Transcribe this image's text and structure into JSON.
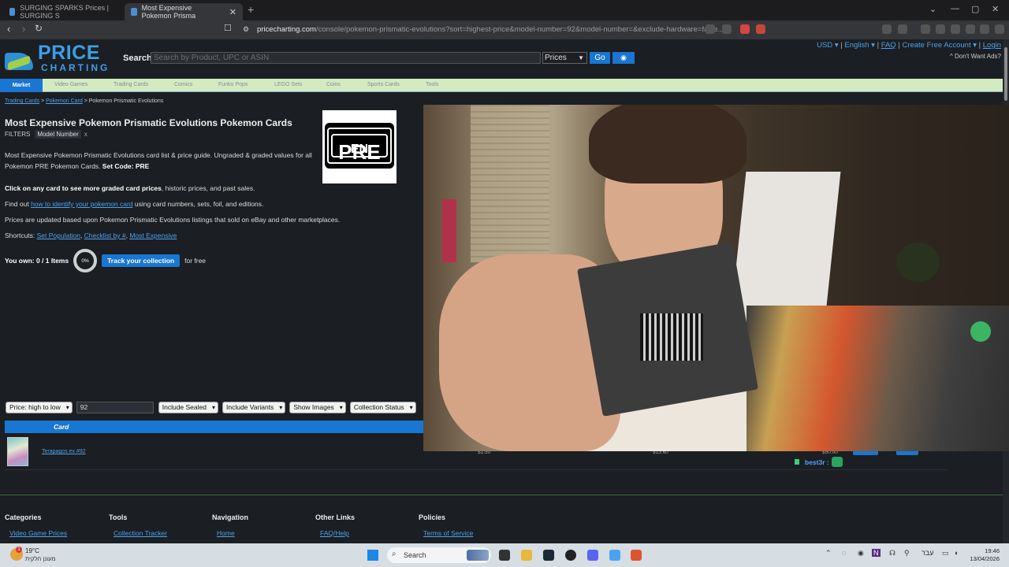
{
  "browser": {
    "tabs": [
      {
        "title": "SURGING SPARKS Prices | SURGING S"
      },
      {
        "title": "Most Expensive Pokemon Prisma"
      }
    ],
    "url_host": "pricecharting.com",
    "url_path": "/console/pokemon-prismatic-evolutions?sort=highest-price&model-number=92&model-number=&exclude-hardware=false..."
  },
  "header": {
    "logo_line1": "PRICE",
    "logo_line2": "CHARTING",
    "search_label": "Search",
    "search_placeholder": "Search by Product, UPC or ASIN",
    "search_type": "Prices",
    "go_label": "Go",
    "links": [
      "USD ▾",
      "English ▾",
      "FAQ",
      "Create Free Account ▾",
      "Login"
    ],
    "dont_want_ads": "^ Don't Want Ads?"
  },
  "categories": [
    "Market",
    "Video Games",
    "Trading Cards",
    "Comics",
    "Funko Pops",
    "LEGO Sets",
    "Coins",
    "Sports Cards",
    "Tools"
  ],
  "breadcrumb": {
    "items": [
      "Trading Cards",
      "Pokemon Card"
    ],
    "current": "Pokemon Prismatic Evolutions"
  },
  "page": {
    "title": "Most Expensive Pokemon Prismatic Evolutions Pokemon Cards",
    "filters_label": "FILTERS",
    "filter_chip": "Model Number",
    "filter_remove": "x",
    "set_logo_main": "PRE",
    "set_logo_sub": "EN",
    "description_1": "Most Expensive Pokemon Prismatic Evolutions card list & price guide. Ungraded & graded values for all Pokemon PRE Pokemon Cards.",
    "set_code": "Set Code: PRE",
    "click_bold": "Click on any card to see more graded card prices",
    "click_rest": ", historic prices, and past sales.",
    "findout_pre": "Find out ",
    "findout_link": "how to identify your pokemon card",
    "findout_post": " using card numbers, sets, foil, and editions.",
    "updated_text": "Prices are updated based upon Pokemon Prismatic Evolutions listings that sold on eBay and other marketplaces.",
    "shortcuts_label": "Shortcuts: ",
    "shortcuts": [
      "Set Population",
      "Checklist by #",
      "Most Expensive"
    ],
    "own_label": "You own: 0 / 1 Items",
    "own_percent": "0%",
    "track_button": "Track your collection",
    "for_free": "for free"
  },
  "controls": {
    "sort": "Price: high to low",
    "model_number": "92",
    "include_sealed": "Include Sealed",
    "include_variants": "Include Variants",
    "show_images": "Show Images",
    "collection_status": "Collection Status"
  },
  "table": {
    "header_card": "Card",
    "rows": [
      {
        "name": "Terapagos ex #92",
        "ungraded": "$1.50",
        "grade9": "$13.60",
        "psa10": "$50.00"
      }
    ],
    "add_collection": "+ Collection",
    "add_wishlist": "+ Wishlist"
  },
  "chat": {
    "user": "best3r :"
  },
  "footer": {
    "columns": [
      {
        "title": "Categories",
        "link": "Video Game Prices"
      },
      {
        "title": "Tools",
        "link": "Collection Tracker"
      },
      {
        "title": "Navigation",
        "link": "Home"
      },
      {
        "title": "Other Links",
        "link": "FAQ/Help"
      },
      {
        "title": "Policies",
        "link": "Terms of Service"
      }
    ]
  },
  "taskbar": {
    "weather_temp": "19°C",
    "weather_desc": "מעונן חלקית",
    "weather_badge": "1",
    "search_label": "Search",
    "lang": "עבר",
    "time": "19:46",
    "date": "13/04/2026"
  },
  "colors": {
    "accent": "#1976d2",
    "link": "#4aa3ef",
    "catbar": "#d4ebc2",
    "background": "#1b1e22"
  }
}
